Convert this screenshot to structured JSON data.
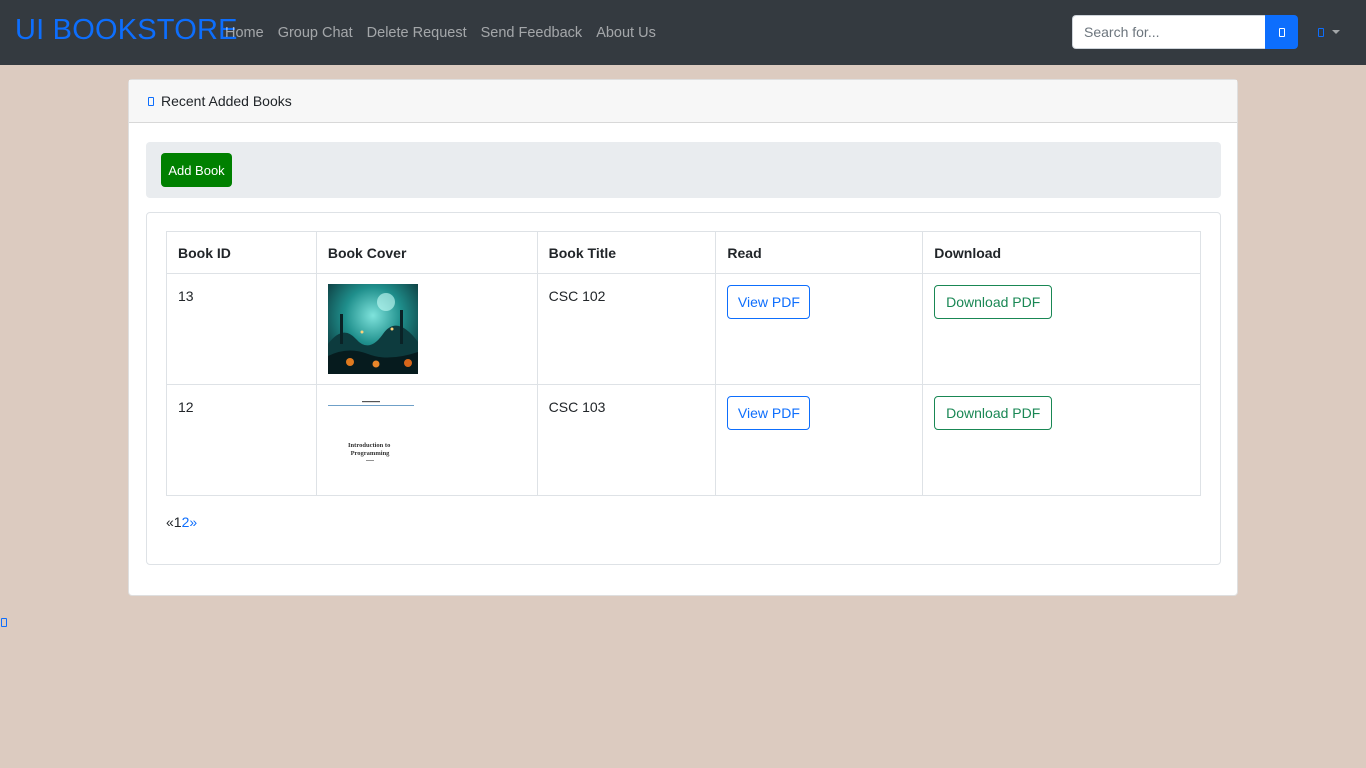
{
  "navbar": {
    "brand": "UI BOOKSTORE",
    "links": [
      {
        "label": "Home"
      },
      {
        "label": "Group Chat"
      },
      {
        "label": "Delete Request"
      },
      {
        "label": "Send Feedback"
      },
      {
        "label": "About Us"
      }
    ],
    "search": {
      "placeholder": "Search for..."
    },
    "search_icon": "search-icon",
    "user_icon": "user-icon",
    "colors": {
      "background": "#343a40",
      "brand": "#0d6efd",
      "accent": "#0d6efd"
    }
  },
  "card": {
    "header_icon": "book-icon",
    "header_title": "Recent Added Books",
    "add_button": "Add Book",
    "add_button_color": "#008000",
    "table": {
      "headers": [
        "Book ID",
        "Book Cover",
        "Book Title",
        "Read",
        "Download"
      ],
      "rows": [
        {
          "id": "13",
          "cover": "dark teal fantasy forest scene with lanterns",
          "title": "CSC 102",
          "read": "View PDF",
          "download": "Download PDF"
        },
        {
          "id": "12",
          "cover": "document page: Introduction to Programming",
          "cover_text": "Introduction to Programming",
          "title": "CSC 103",
          "read": "View PDF",
          "download": "Download PDF"
        }
      ]
    },
    "pagination": {
      "prev": "«",
      "current": "1",
      "next_page": "2",
      "next": "»"
    }
  },
  "side_icon": "floating-icon",
  "page_background": "#dccbc0"
}
